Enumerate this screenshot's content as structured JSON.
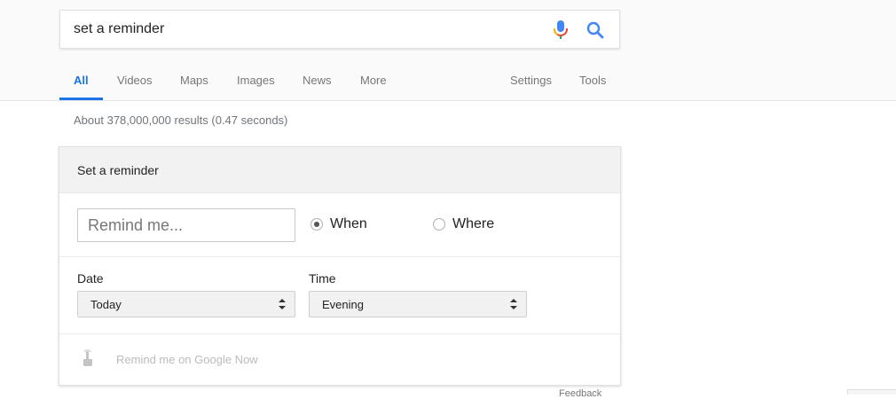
{
  "search": {
    "query": "set a reminder",
    "mic_icon": "microphone-icon",
    "search_icon": "magnifier-icon"
  },
  "tabs": {
    "all": "All",
    "videos": "Videos",
    "maps": "Maps",
    "images": "Images",
    "news": "News",
    "more": "More",
    "settings": "Settings",
    "tools": "Tools",
    "active": "All"
  },
  "results": {
    "stats": "About 378,000,000 results (0.47 seconds)"
  },
  "reminder": {
    "title": "Set a reminder",
    "input_placeholder": "Remind me...",
    "when_label": "When",
    "where_label": "Where",
    "selected_option": "When",
    "date_label": "Date",
    "date_value": "Today",
    "time_label": "Time",
    "time_value": "Evening",
    "google_now_label": "Remind me on Google Now",
    "google_now_icon": "touch-icon"
  },
  "footer": {
    "feedback": "Feedback"
  },
  "colors": {
    "accent": "#1a73e8",
    "header_bg": "#fafafa",
    "card_head_bg": "#f2f2f2"
  }
}
